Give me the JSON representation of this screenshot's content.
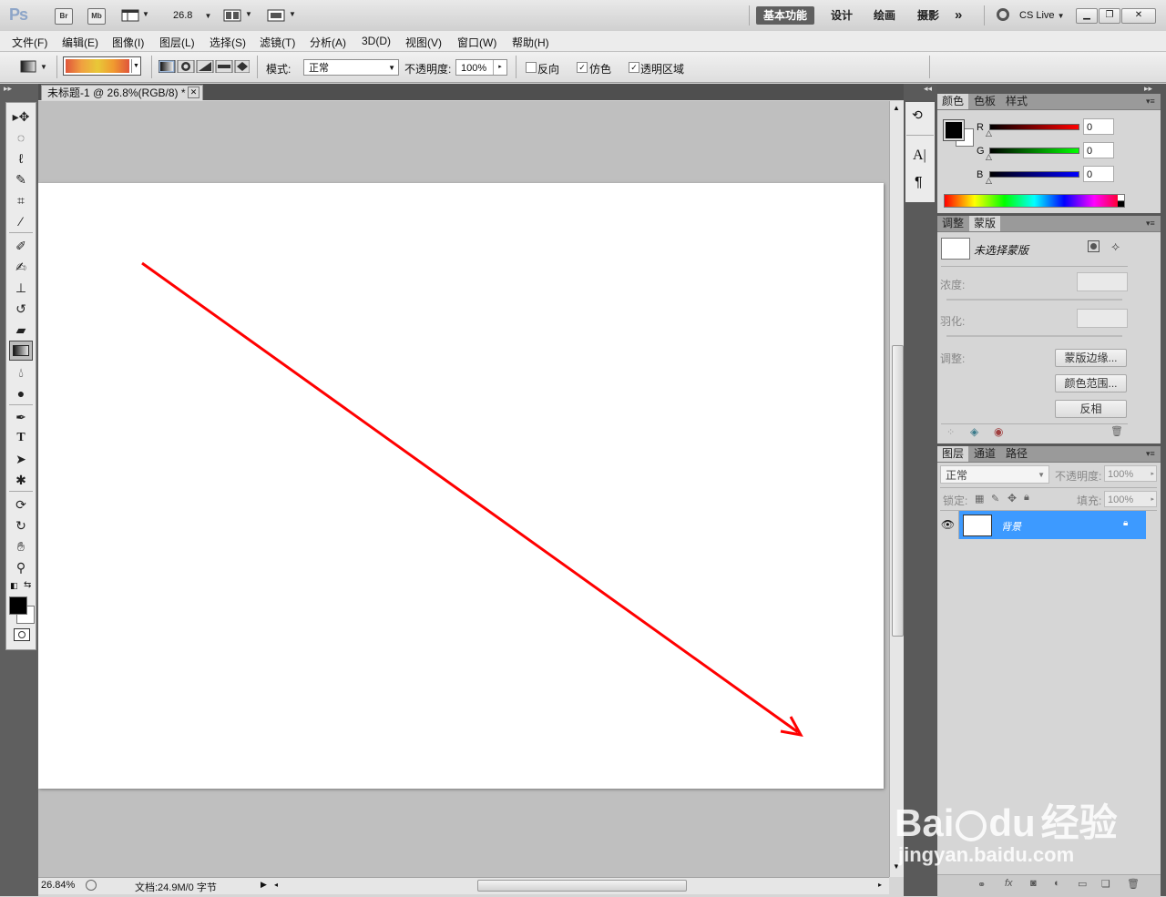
{
  "app": {
    "logo": "Ps",
    "bridge_label": "Br",
    "minibridge_label": "Mb",
    "zoom_dropdown": "26.8",
    "workspaces": [
      "基本功能",
      "设计",
      "绘画",
      "摄影"
    ],
    "more_workspaces": "»",
    "cs_live": "CS Live"
  },
  "menus": [
    "文件(F)",
    "编辑(E)",
    "图像(I)",
    "图层(L)",
    "选择(S)",
    "滤镜(T)",
    "分析(A)",
    "3D(D)",
    "视图(V)",
    "窗口(W)",
    "帮助(H)"
  ],
  "options": {
    "mode_label": "模式:",
    "mode_value": "正常",
    "opacity_label": "不透明度:",
    "opacity_value": "100%",
    "reverse_label": "反向",
    "reverse_checked": false,
    "dither_label": "仿色",
    "dither_checked": true,
    "transparency_label": "透明区域",
    "transparency_checked": true
  },
  "document": {
    "tab_title": "未标题-1 @ 26.8%(RGB/8) *",
    "zoom_status": "26.84%",
    "doc_info": "文档:24.9M/0 字节"
  },
  "color_panel": {
    "tabs": [
      "颜色",
      "色板",
      "样式"
    ],
    "r_label": "R",
    "r_value": "0",
    "g_label": "G",
    "g_value": "0",
    "b_label": "B",
    "b_value": "0"
  },
  "masks_panel": {
    "tabs": [
      "调整",
      "蒙版"
    ],
    "no_mask_label": "未选择蒙版",
    "density_label": "浓度:",
    "feather_label": "羽化:",
    "refine_label": "调整:",
    "mask_edge_button": "蒙版边缘...",
    "color_range_button": "颜色范围...",
    "invert_button": "反相"
  },
  "layers_panel": {
    "tabs": [
      "图层",
      "通道",
      "路径"
    ],
    "blend_mode": "正常",
    "opacity_label": "不透明度:",
    "opacity_value": "100%",
    "lock_label": "锁定:",
    "fill_label": "填充:",
    "fill_value": "100%",
    "layers": [
      {
        "name": "背景",
        "locked": true,
        "visible": true
      }
    ]
  },
  "watermark": {
    "brand": "Bai",
    "brand2": "du",
    "cn": "经验",
    "url": "jingyan.baidu.com"
  },
  "colors": {
    "accent": "#3d9aff",
    "arrow": "#ff0000",
    "foreground": "#000000",
    "background": "#ffffff"
  }
}
